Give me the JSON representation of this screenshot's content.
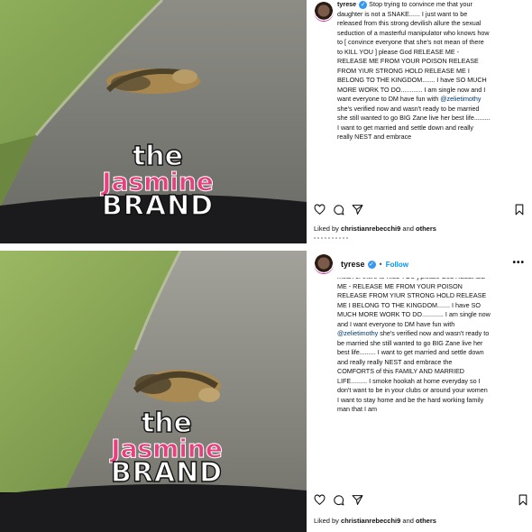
{
  "panels": [
    {
      "id": "top",
      "watermark": {
        "the": "the",
        "jasmine": "Jasmine",
        "brand": "BRAND"
      },
      "post": {
        "username": "tyrese",
        "caption_lead": "tyrese",
        "caption_part1": " Stop trying to convince me that your daughter is not a SNAKE...... I just want to be released from this strong devilish allure the sexual seduction of a masterful manipulator who knows how to [ convince everyone that she's not mean of there to KILL YOU ] please God RELEASE ME - RELEASE ME FROM YOUR POISON RELEASE FROM YIUR STRONG HOLD RELEASE ME I BELONG TO THE KINGDOM....... I have SO MUCH MORE WORK TO DO............ I am single now and I want everyone to DM have fun with ",
        "mention": "@zelietimothy",
        "caption_part2": " she's verified now and wasn't ready to be married she still wanted to go BIG Zane live her best life......... I want to get married and settle down and really really NEST and embrace",
        "likes_prefix": "Liked by ",
        "likes_user": "christianrebecchi9",
        "likes_middle": " and ",
        "likes_others": "others",
        "icons": [
          "heart-icon",
          "comment-icon",
          "share-icon",
          "bookmark-icon"
        ]
      }
    },
    {
      "id": "bottom",
      "watermark": {
        "the": "the",
        "jasmine": "Jasmine",
        "brand": "BRAND"
      },
      "post": {
        "username": "tyrese",
        "separator": "•",
        "follow_label": "Follow",
        "more_label": "•••",
        "caption": "mean of there to KILL YOU ] please God RELEASE ME - RELEASE ME FROM YOUR POISON RELEASE FROM YIUR STRONG HOLD RELEASE ME I BELONG TO THE KINGDOM....... I have SO MUCH MORE WORK TO DO............ I am single now and I want everyone to DM have fun with ",
        "mention": "@zelietimothy",
        "caption_part2": " she's verified now and wasn't ready to be married she still wanted to go BIG Zane live her best life......... I want to get married and settle down and really really NEST and embrace the COMFORTS of this FAMILY AND MARRIED LIFE......... I smoke hookah at home everyday so I don't want to be in your clubs or around your women I want to stay home and be the hard working family man that I am",
        "likes_prefix": "Liked by ",
        "likes_user": "christianrebecchi9",
        "likes_middle": " and ",
        "likes_others": "others",
        "icons": [
          "heart-icon",
          "comment-icon",
          "share-icon",
          "bookmark-icon"
        ]
      }
    }
  ],
  "colors": {
    "brand_pink": "#e8407e",
    "verified_blue": "#3897f0",
    "follow_blue": "#0095f6",
    "mention_blue": "#00376b"
  }
}
